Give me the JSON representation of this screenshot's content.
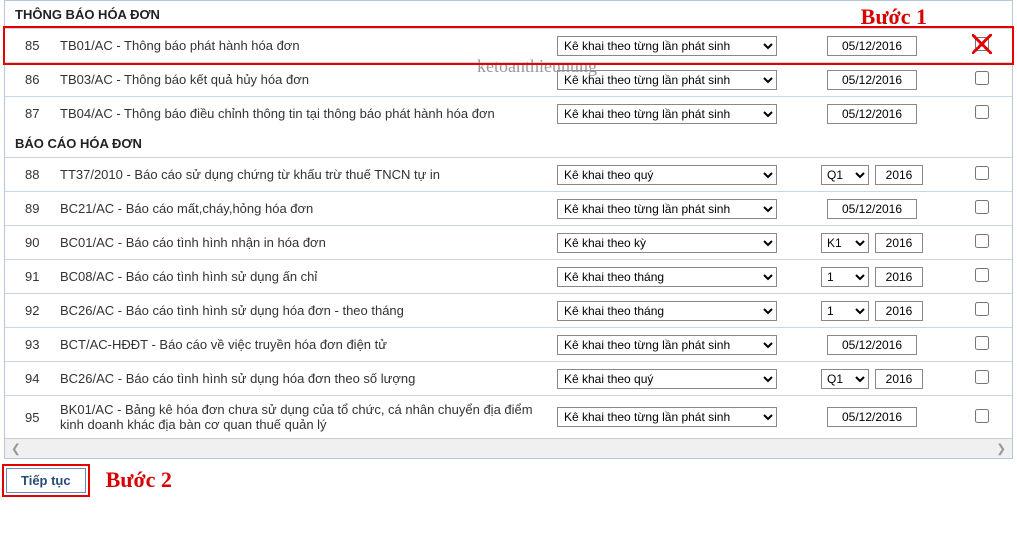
{
  "watermark": "ketoanthieunung",
  "step1_label": "Bước 1",
  "step2_label": "Bước 2",
  "continue_button": "Tiếp tục",
  "sections": [
    {
      "title": "THÔNG BÁO HÓA ĐƠN",
      "rows": [
        {
          "num": "85",
          "desc": "TB01/AC - Thông báo phát hành hóa đơn",
          "period": "Kê khai theo từng lần phát sinh",
          "date_mode": "date",
          "date": "05/12/2016",
          "highlight": true,
          "cross": true
        },
        {
          "num": "86",
          "desc": "TB03/AC - Thông báo kết quả hủy hóa đơn",
          "period": "Kê khai theo từng lần phát sinh",
          "date_mode": "date",
          "date": "05/12/2016"
        },
        {
          "num": "87",
          "desc": "TB04/AC - Thông báo điều chỉnh thông tin tại thông báo phát hành hóa đơn",
          "period": "Kê khai theo từng lần phát sinh",
          "date_mode": "date",
          "date": "05/12/2016"
        }
      ]
    },
    {
      "title": "BÁO CÁO HÓA ĐƠN",
      "rows": [
        {
          "num": "88",
          "desc": "TT37/2010 - Báo cáo sử dụng chứng từ khấu trừ thuế TNCN tự in",
          "period": "Kê khai theo quý",
          "date_mode": "qy",
          "q": "Q1",
          "year": "2016"
        },
        {
          "num": "89",
          "desc": "BC21/AC - Báo cáo mất,cháy,hỏng hóa đơn",
          "period": "Kê khai theo từng lần phát sinh",
          "date_mode": "date",
          "date": "05/12/2016"
        },
        {
          "num": "90",
          "desc": "BC01/AC - Báo cáo tình hình nhận in hóa đơn",
          "period": "Kê khai theo kỳ",
          "date_mode": "qy",
          "q": "K1",
          "year": "2016"
        },
        {
          "num": "91",
          "desc": "BC08/AC - Báo cáo tình hình sử dụng ấn chỉ",
          "period": "Kê khai theo tháng",
          "date_mode": "qy",
          "q": "1",
          "year": "2016"
        },
        {
          "num": "92",
          "desc": "BC26/AC - Báo cáo tình hình sử dụng hóa đơn - theo tháng",
          "period": "Kê khai theo tháng",
          "date_mode": "qy",
          "q": "1",
          "year": "2016"
        },
        {
          "num": "93",
          "desc": "BCT/AC-HĐĐT - Báo cáo về việc truyền hóa đơn điện tử",
          "period": "Kê khai theo từng lần phát sinh",
          "date_mode": "date",
          "date": "05/12/2016"
        },
        {
          "num": "94",
          "desc": "BC26/AC - Báo cáo tình hình sử dụng hóa đơn theo số lượng",
          "period": "Kê khai theo quý",
          "date_mode": "qy",
          "q": "Q1",
          "year": "2016"
        },
        {
          "num": "95",
          "desc": "BK01/AC - Bảng kê hóa đơn chưa sử dụng của tổ chức, cá nhân chuyển địa điểm kinh doanh khác địa bàn cơ quan thuế quản lý",
          "period": "Kê khai theo từng lần phát sinh",
          "date_mode": "date",
          "date": "05/12/2016"
        }
      ]
    }
  ]
}
